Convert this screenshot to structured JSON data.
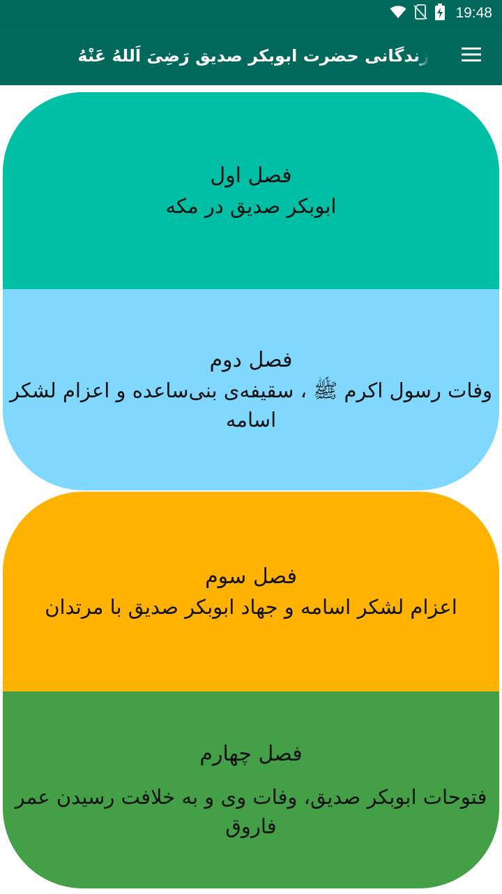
{
  "status_bar": {
    "time": "19:48",
    "icons": [
      "wifi-icon",
      "no-sim-icon",
      "battery-charging-icon"
    ]
  },
  "app_bar": {
    "title": "زندگانی حضرت ابوبکر صدیق رَضِیَ اَللهُ عَنْهُ",
    "menu_icon": "hamburger-menu-icon"
  },
  "chapters": [
    {
      "title": "فصل اول",
      "subtitle": "ابوبکر صدیق  در مکه",
      "color": "#00bfa5"
    },
    {
      "title": "فصل دوم",
      "subtitle": "وفات رسول اکرم ﷺ ، سقیفه‌ی بنی‌ساعده و اعزام لشکر اسامه",
      "color": "#80d8ff"
    },
    {
      "title": "فصل سوم",
      "subtitle": "اعزام لشکر اسامه و جهاد ابوبکر صدیق با مرتدان",
      "color": "#ffb300"
    },
    {
      "title": "فصل چهارم",
      "subtitle": "فتوحات ابوبکر صدیق، وفات وی و به خلافت رسیدن عمر فاروق",
      "color": "#43a047"
    }
  ]
}
